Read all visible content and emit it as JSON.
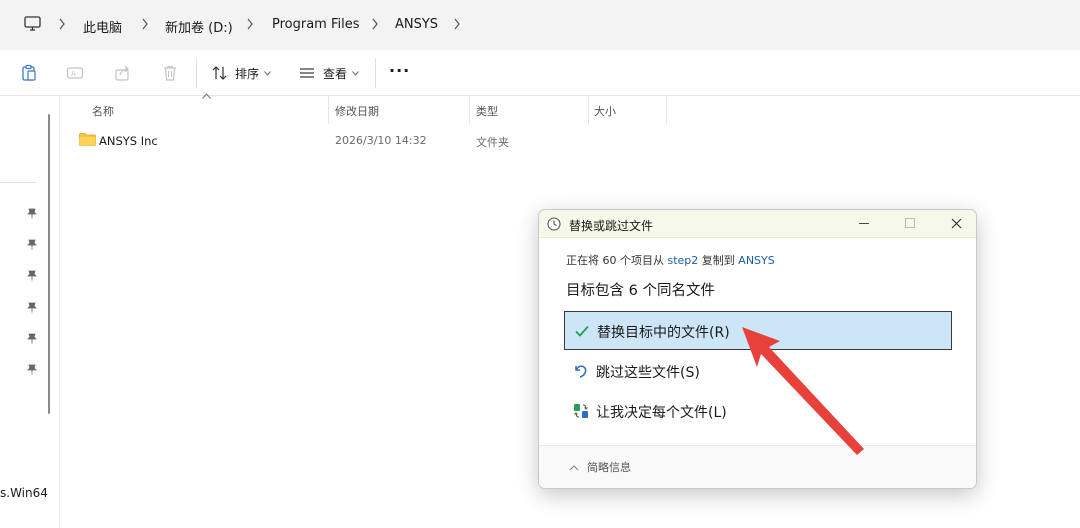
{
  "address_bar": {
    "crumbs": [
      "此电脑",
      "新加卷 (D:)",
      "Program Files",
      "ANSYS"
    ]
  },
  "toolbar": {
    "sort_label": "排序",
    "view_label": "查看",
    "more_label": "···"
  },
  "nav": {
    "partial_item": "s.Win64"
  },
  "file_list": {
    "columns": [
      "名称",
      "修改日期",
      "类型",
      "大小"
    ],
    "rows": [
      {
        "name": "ANSYS Inc",
        "modified": "2026/3/10 14:32",
        "type": "文件夹",
        "size": ""
      }
    ]
  },
  "dialog": {
    "title": "替换或跳过文件",
    "sub_prefix": "正在将 60 个项目从",
    "source": "step2",
    "sub_middle": "复制到",
    "target": "ANSYS",
    "heading": "目标包含 6 个同名文件",
    "options": [
      {
        "label": "替换目标中的文件(R)",
        "icon": "checkmark-icon",
        "selected": true
      },
      {
        "label": "跳过这些文件(S)",
        "icon": "undo-icon",
        "selected": false
      },
      {
        "label": "让我决定每个文件(L)",
        "icon": "compare-icon",
        "selected": false
      }
    ],
    "details_label": "简略信息"
  },
  "colors": {
    "selection_bg": "#cde6f7",
    "link": "#1b5fa8",
    "annotation_arrow": "#e8403a",
    "checkmark": "#1e9e4a"
  }
}
